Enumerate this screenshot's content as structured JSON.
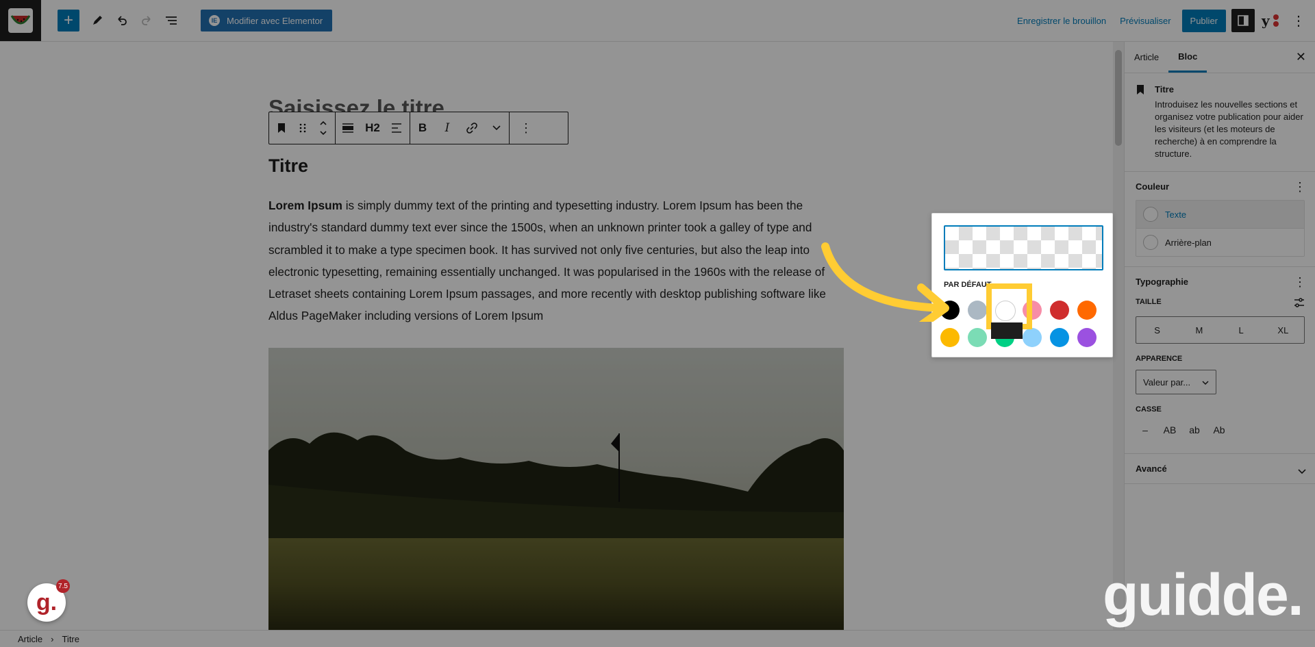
{
  "toolbar": {
    "add_label": "+",
    "elementor_badge": "IE",
    "elementor_label": "Modifier avec Elementor",
    "save_draft": "Enregistrer le brouillon",
    "preview": "Prévisualiser",
    "publish": "Publier"
  },
  "editor": {
    "post_title_placeholder": "Saisissez le titre",
    "heading": "Titre",
    "para_bold": "Lorem Ipsum",
    "para_rest": " is simply dummy text of the printing and typesetting industry. Lorem Ipsum has been the industry's standard dummy text ever since the 1500s, when an unknown printer took a galley of type and scrambled it to make a type specimen book. It has survived not only five centuries, but also the leap into electronic typesetting, remaining essentially unchanged. It was popularised in the 1960s with the release of Letraset sheets containing Lorem Ipsum passages, and more recently with desktop publishing software like Aldus PageMaker including versions of Lorem Ipsum",
    "heading_level": "H2"
  },
  "sidebar": {
    "tabs": [
      {
        "label": "Article"
      },
      {
        "label": "Bloc"
      }
    ],
    "block_title": "Titre",
    "block_desc": "Introduisez les nouvelles sections et organisez votre publication pour aider les visiteurs (et les moteurs de recherche) à en comprendre la structure.",
    "couleur": {
      "title": "Couleur",
      "items": [
        {
          "label": "Texte"
        },
        {
          "label": "Arrière-plan"
        }
      ]
    },
    "typographie": {
      "title": "Typographie",
      "size_label": "TAILLE",
      "sizes": [
        "S",
        "M",
        "L",
        "XL"
      ],
      "appearance_label": "APPARENCE",
      "appearance_value": "Valeur par...",
      "casse_label": "CASSE",
      "casse": [
        "–",
        "AB",
        "ab",
        "Ab"
      ]
    },
    "avance": "Avancé"
  },
  "popover": {
    "label": "PAR DÉFAUT",
    "swatches": [
      "#000000",
      "#abb8c3",
      "#ffffff",
      "#f78da7",
      "#cf2e2e",
      "#ff6900",
      "#fcb900",
      "#7bdcb5",
      "#00d084",
      "#8ed1fc",
      "#0693e3",
      "#9b51e0"
    ]
  },
  "breadcrumbs": [
    "Article",
    "Titre"
  ],
  "badge": {
    "letter": "g.",
    "count": "7.5"
  },
  "watermark": "guidde.",
  "colors": {
    "accent": "#007cba",
    "highlight": "#ffcc33"
  }
}
